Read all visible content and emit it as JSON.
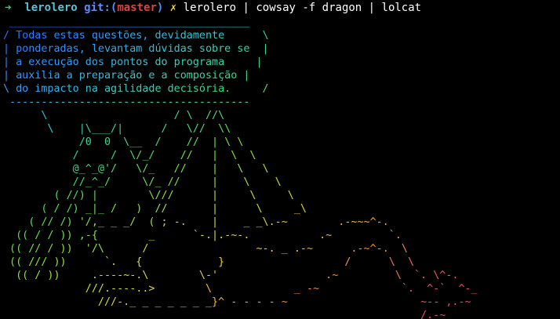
{
  "prompt": {
    "arrow": "➜",
    "directory": "lerolero",
    "git_label": "git:(",
    "branch": "master",
    "git_close": ")",
    "dirty": "✗",
    "command": "lerolero | cowsay -f dragon | lolcat"
  },
  "speech_bubble": [
    " ______________________________________",
    "/ Todas estas questões, devidamente      \\",
    "| ponderadas, levantam dúvidas sobre se  |",
    "| a execução dos pontos do programa     |",
    "| auxilia a preparação e a composição |",
    "\\ do impacto na agilidade decisória.     /",
    " --------------------------------------"
  ],
  "dragon_art": [
    "      \\                    / \\  //\\",
    "       \\    |\\___/|      /   \\//  \\\\",
    "            /0  0  \\__  /    //  | \\ \\",
    "           /     /  \\/_/    //   |  \\  \\",
    "           @_^_@'/   \\/_   //    |   \\   \\",
    "           //_^_/     \\/_ //     |    \\    \\",
    "        ( //) |        \\///      |     \\     \\",
    "      ( / /) _|_ /   )  //       |      \\     _\\",
    "    ( // /) '/,_ _ _/  ( ; -.    |    _ _\\.-~        .-~~~^-.",
    "  (( / / )) ,-{        _      `-.|.-~-.           .~         `.",
    " (( // / ))  '/\\      /                 ~-. _ .-~      .-~^-.  \\",
    " (( /// ))      `.   {            }                   /      \\  \\",
    "  (( / ))     .----~-.\\        \\-'                 .~         \\  `. \\^-.",
    "             ///.----..>        \\             _ -~             `.  ^-`  ^-_",
    "               ///-._ _ _ _ _ _ _}^ - - - - ~                     ~-- ,.-~",
    "                                                                  /.-~"
  ],
  "colors": {
    "background": "#000000",
    "gradient": [
      "#1e6bff",
      "#2f9bff",
      "#2fd0c8",
      "#38d97a",
      "#7ee33a",
      "#c9e03a",
      "#f2c33a",
      "#f48a3a",
      "#f24f6a",
      "#e0406f"
    ]
  }
}
